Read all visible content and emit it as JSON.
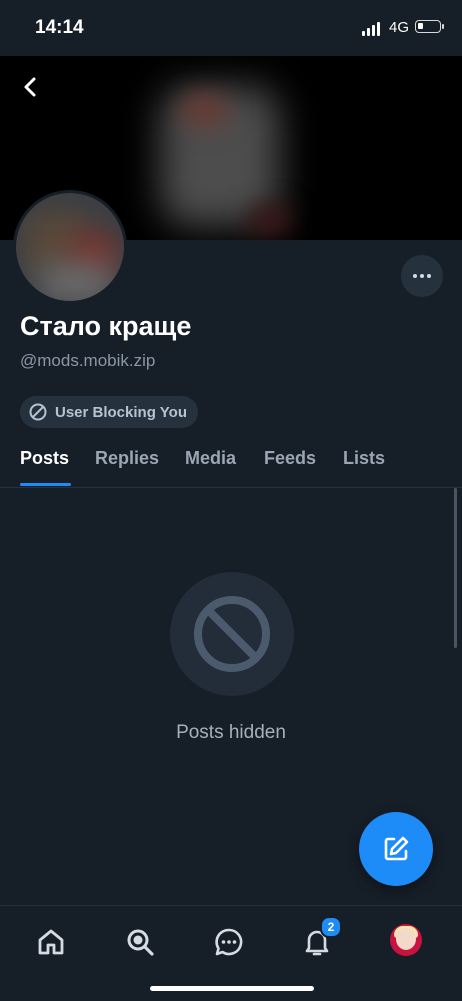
{
  "status_bar": {
    "time": "14:14",
    "network": "4G"
  },
  "profile": {
    "display_name": "Стало краще",
    "handle": "@mods.mobik.zip",
    "blocking_label": "User Blocking You"
  },
  "tabs": [
    {
      "label": "Posts",
      "active": true
    },
    {
      "label": "Replies",
      "active": false
    },
    {
      "label": "Media",
      "active": false
    },
    {
      "label": "Feeds",
      "active": false
    },
    {
      "label": "Lists",
      "active": false
    }
  ],
  "content": {
    "empty_message": "Posts hidden"
  },
  "bottom_nav": {
    "items": [
      "home-icon",
      "search-icon",
      "chat-icon",
      "bell-icon",
      "profile-avatar"
    ],
    "notification_badge": "2"
  },
  "colors": {
    "background": "#161e27",
    "accent": "#1d8cf8",
    "pill": "#26313e"
  }
}
